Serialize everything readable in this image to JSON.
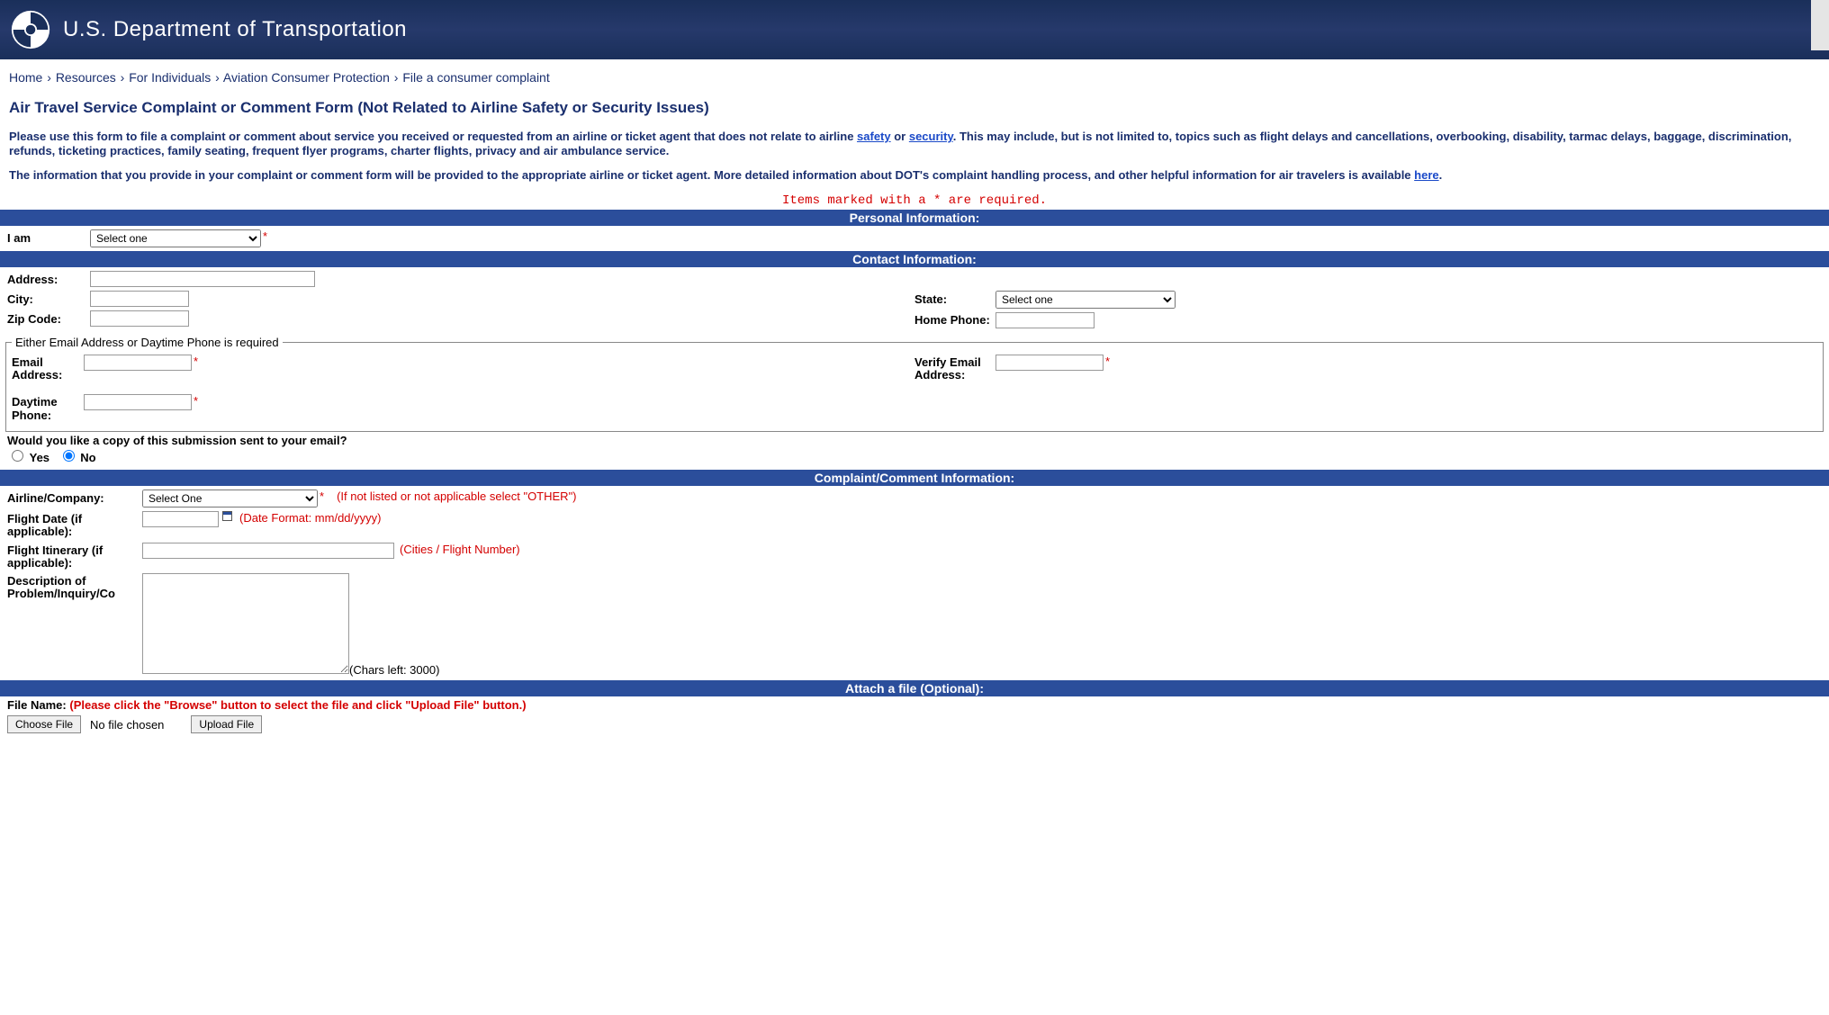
{
  "header": {
    "title": "U.S. Department of Transportation"
  },
  "breadcrumb": {
    "items": [
      "Home",
      "Resources",
      "For Individuals",
      "Aviation Consumer Protection",
      "File a consumer complaint"
    ]
  },
  "page_title": "Air Travel Service Complaint or Comment Form  (Not Related to Airline Safety or Security Issues)",
  "intro": {
    "p1a": "Please use this form to file a complaint or comment about service you received or requested from an airline or ticket agent that does not relate to airline ",
    "safety_link": "safety",
    "p1b": " or ",
    "security_link": "security",
    "p1c": ". This may include, but is not limited to, topics such as flight delays and cancellations, overbooking, disability, tarmac delays, baggage, discrimination, refunds, ticketing practices, family seating, frequent flyer programs, charter flights, privacy and air ambulance service.",
    "p2a": "The information that you provide in your complaint or comment form will be provided to the appropriate airline or ticket agent. More detailed information about DOT's complaint handling process, and other helpful information for air travelers is available ",
    "here_link": "here",
    "p2b": "."
  },
  "required_note": "Items marked with a * are required.",
  "sections": {
    "personal": "Personal Information:",
    "contact": "Contact Information:",
    "complaint": "Complaint/Comment Information:",
    "attach": "Attach a file (Optional):"
  },
  "labels": {
    "i_am": "I am",
    "address": "Address:",
    "city": "City:",
    "state": "State:",
    "zip": "Zip Code:",
    "home_phone": "Home Phone:",
    "legend_email_phone": "Either Email Address or Daytime Phone is required",
    "email": "Email Address:",
    "verify_email": "Verify Email Address:",
    "daytime_phone": "Daytime Phone:",
    "copy_q": "Would you like a copy of this submission sent to your email?",
    "yes": "Yes",
    "no": "No",
    "airline": "Airline/Company:",
    "airline_hint": "(If not listed or not applicable select \"OTHER\")",
    "flight_date": "Flight Date (if applicable):",
    "date_hint": "(Date Format: mm/dd/yyyy)",
    "itinerary": "Flight Itinerary (if applicable):",
    "itinerary_hint": "(Cities / Flight Number)",
    "description": "Description of Problem/Inquiry/Co",
    "chars_left": "(Chars left: 3000)",
    "file_name": "File Name:",
    "file_hint": "(Please click the \"Browse\" button to select the file and click \"Upload File\" button.)",
    "choose_file": "Choose File",
    "no_file": "No file chosen",
    "upload": "Upload File"
  },
  "selects": {
    "i_am": "Select one",
    "state": "Select one",
    "airline": "Select One"
  }
}
